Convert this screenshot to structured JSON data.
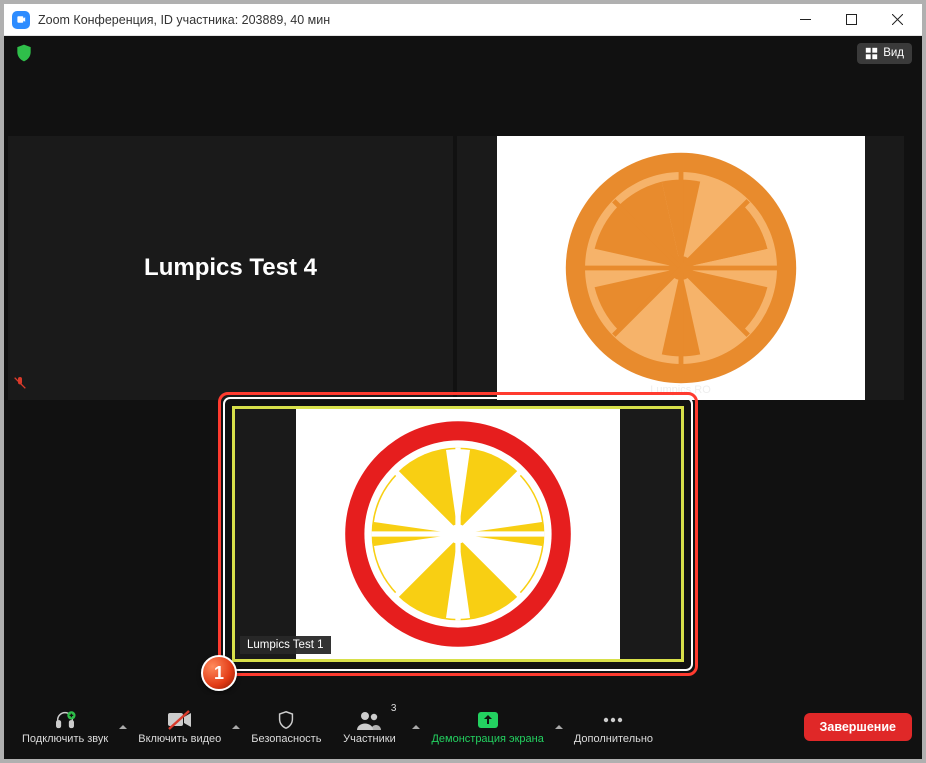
{
  "window": {
    "title": "Zoom Конференция, ID участника: 203889, 40 мин"
  },
  "topbar": {
    "view_label": "Вид"
  },
  "participants": {
    "tile_left_name": "Lumpics Test 4",
    "tile_right_name": "Lumpics RO",
    "self_name": "Lumpics Test 1"
  },
  "annotation": {
    "badge": "1"
  },
  "toolbar": {
    "audio": "Подключить звук",
    "video": "Включить видео",
    "security": "Безопасность",
    "participants": "Участники",
    "participants_count": "3",
    "share": "Демонстрация экрана",
    "more": "Дополнительно",
    "end": "Завершение"
  },
  "colors": {
    "orange_outer": "#e88b2d",
    "orange_inner": "#f6b36a",
    "lemon_ring": "#e61e1e",
    "lemon_fill": "#f8cf13"
  }
}
